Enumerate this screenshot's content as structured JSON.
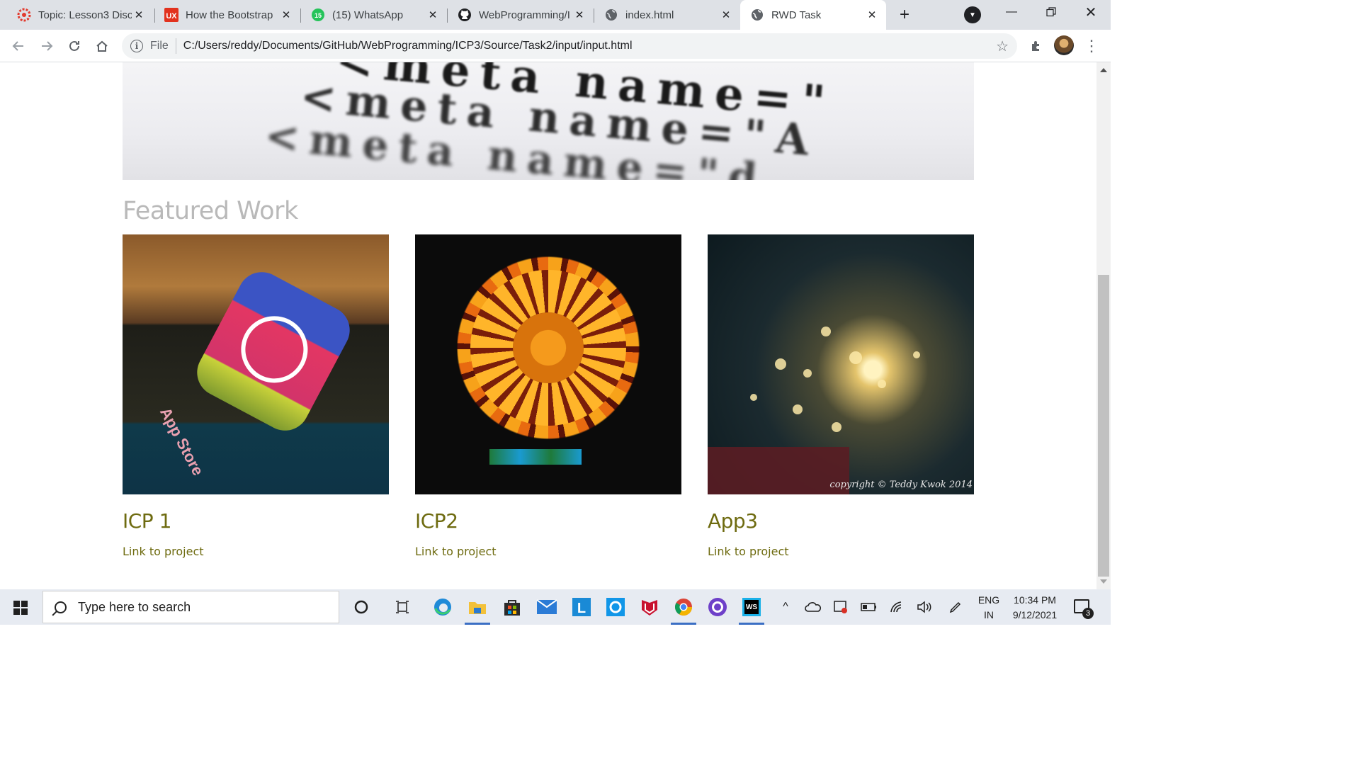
{
  "browser": {
    "tabs": [
      {
        "label": "Topic: Lesson3 Disc",
        "icon": "canvas-icon"
      },
      {
        "label": "How the Bootstrap",
        "icon": "ux-icon"
      },
      {
        "label": "(15) WhatsApp",
        "icon": "whatsapp-icon"
      },
      {
        "label": "WebProgramming/I",
        "icon": "github-icon"
      },
      {
        "label": "index.html",
        "icon": "globe-icon"
      },
      {
        "label": "RWD Task",
        "icon": "globe-icon"
      }
    ],
    "active_tab_index": 5,
    "address": {
      "scheme_label": "File",
      "url": "C:/Users/reddy/Documents/GitHub/WebProgramming/ICP3/Source/Task2/input/input.html"
    },
    "whatsapp_badge": "15"
  },
  "page": {
    "hero_lines": [
      "<meta  name=\"",
      "<meta  name=\"A",
      "<meta  name=\"d"
    ],
    "section_title": "Featured Work",
    "projects": [
      {
        "title": "ICP 1",
        "link": "Link to project"
      },
      {
        "title": "ICP2",
        "link": "Link to project"
      },
      {
        "title": "App3",
        "link": "Link to project",
        "caption": "copyright © Teddy Kwok 2014"
      }
    ],
    "thumb1_text": "App Store"
  },
  "taskbar": {
    "search_placeholder": "Type here to search",
    "language_top": "ENG",
    "language_bottom": "IN",
    "time": "10:34 PM",
    "date": "9/12/2021",
    "notification_count": "3"
  },
  "colors": {
    "accent_olive": "#6e6b10",
    "section_title_gray": "#b9b9b9",
    "tabstrip_bg": "#dee1e6",
    "taskbar_bg": "#e7ebf2"
  }
}
